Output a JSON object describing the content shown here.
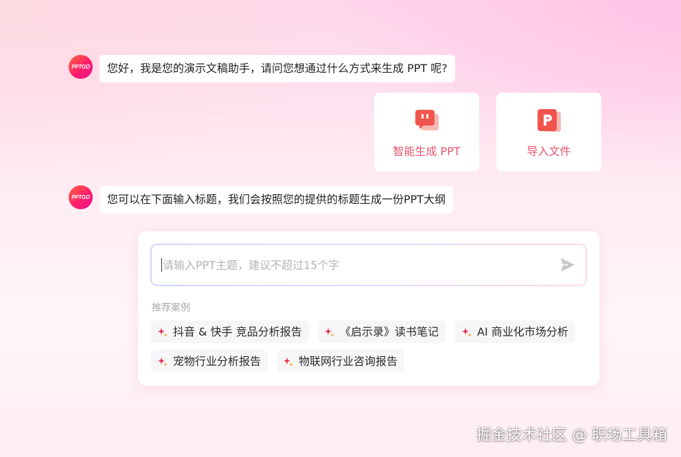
{
  "avatar": {
    "text": "PPTGO"
  },
  "messages": [
    {
      "text": "您好，我是您的演示文稿助手，请问您想通过什么方式来生成 PPT 呢?"
    },
    {
      "text": "您可以在下面输入标题，我们会按照您的提供的标题生成一份PPT大纲"
    }
  ],
  "options": [
    {
      "label": "智能生成 PPT",
      "icon": "chat-bubble-icon"
    },
    {
      "label": "导入文件",
      "icon": "ppt-file-icon"
    }
  ],
  "input": {
    "placeholder": "请输入PPT主题，建议不超过15个字",
    "value": ""
  },
  "recommend": {
    "title": "推荐案例",
    "items": [
      {
        "label": "抖音 & 快手 竞品分析报告"
      },
      {
        "label": "《启示录》读书笔记"
      },
      {
        "label": "AI 商业化市场分析"
      },
      {
        "label": "宠物行业分析报告"
      },
      {
        "label": "物联网行业咨询报告"
      }
    ]
  },
  "watermark": "掘金技术社区 @ 职场工具箱",
  "colors": {
    "accent": "#e8536e",
    "icon_red": "#f0564e"
  }
}
